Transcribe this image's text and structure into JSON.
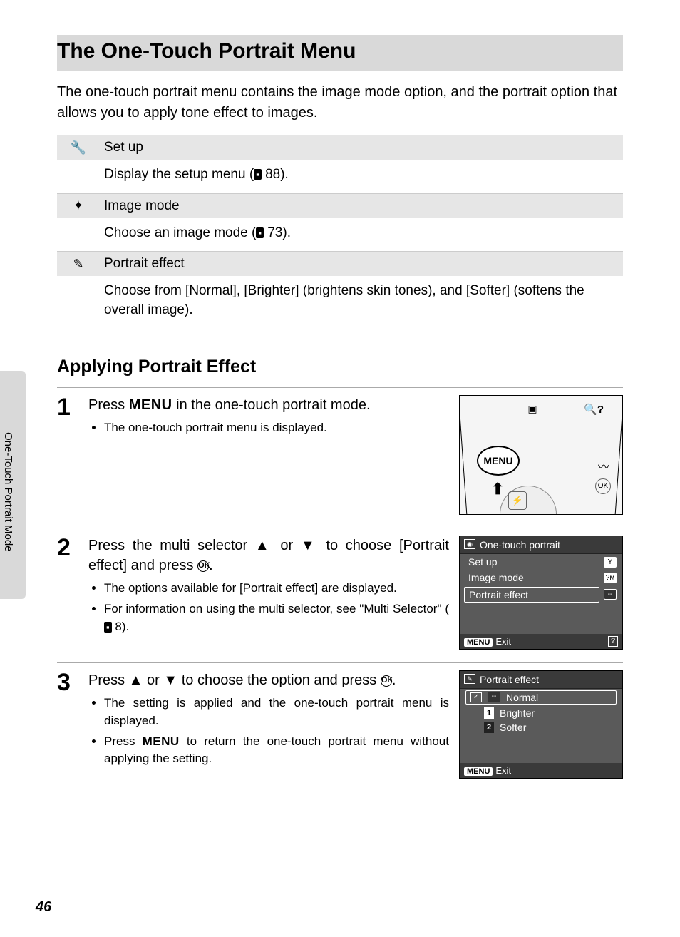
{
  "title": "The One-Touch Portrait Menu",
  "intro": "The one-touch portrait menu contains the image mode option, and the portrait option that allows you to apply tone effect to images.",
  "options": {
    "setup": {
      "label": "Set up",
      "desc_pre": "Display the setup menu (",
      "ref": "88",
      "desc_post": ")."
    },
    "image_mode": {
      "label": "Image mode",
      "desc_pre": "Choose an image mode (",
      "ref": "73",
      "desc_post": ")."
    },
    "portrait_effect": {
      "label": "Portrait effect",
      "desc": "Choose from [Normal], [Brighter] (brightens skin tones), and [Softer] (softens the overall image)."
    }
  },
  "subtitle": "Applying Portrait Effect",
  "steps": {
    "s1": {
      "num": "1",
      "main_a": "Press ",
      "menu": "MENU",
      "main_b": " in the one-touch portrait mode.",
      "bullets": [
        "The one-touch portrait menu is displayed."
      ]
    },
    "s2": {
      "num": "2",
      "main": "Press the multi selector ▲ or ▼ to choose [Portrait effect] and press ",
      "main_end": ".",
      "bullets": [
        "The options available for [Portrait effect] are displayed.",
        "For information on using the multi selector, see \"Multi Selector\" ("
      ],
      "bullet2_ref": "8",
      "bullet2_end": ")."
    },
    "s3": {
      "num": "3",
      "main": "Press ▲ or ▼ to choose the option and press ",
      "main_end": ".",
      "bullets_a": "The setting is applied and the one-touch portrait menu is displayed.",
      "bullets_b_pre": "Press ",
      "bullets_b_menu": "MENU",
      "bullets_b_post": " to return the one-touch portrait menu without applying the setting."
    }
  },
  "lcd1": {
    "title": "One-touch portrait",
    "rows": [
      "Set up",
      "Image mode",
      "Portrait effect"
    ],
    "exit": "Exit",
    "menu": "MENU"
  },
  "lcd2": {
    "title": "Portrait effect",
    "rows": [
      "Normal",
      "Brighter",
      "Softer"
    ],
    "exit": "Exit",
    "menu": "MENU"
  },
  "camera": {
    "menu": "MENU",
    "ok": "OK"
  },
  "side_tab": "One-Touch Portrait Mode",
  "page_number": "46",
  "glyphs": {
    "ok": "OK",
    "up": "▲",
    "down": "▼"
  }
}
